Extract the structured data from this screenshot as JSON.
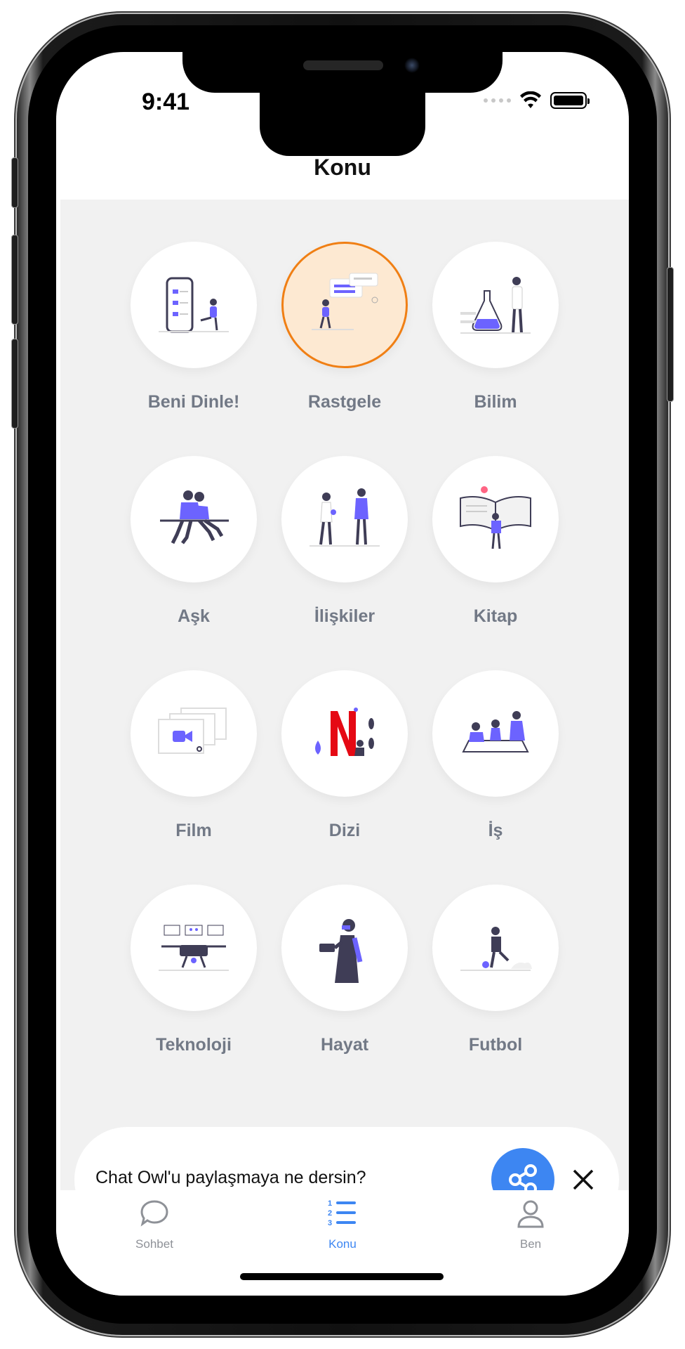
{
  "status_bar": {
    "time": "9:41"
  },
  "header": {
    "title": "Konu"
  },
  "topics": [
    {
      "label": "Beni Dinle!",
      "icon": "phone-checklist-illustration",
      "selected": false
    },
    {
      "label": "Rastgele",
      "icon": "chat-messages-illustration",
      "selected": true
    },
    {
      "label": "Bilim",
      "icon": "science-lab-illustration",
      "selected": false
    },
    {
      "label": "Aşk",
      "icon": "couple-sitting-illustration",
      "selected": false
    },
    {
      "label": "İlişkiler",
      "icon": "two-people-talking-illustration",
      "selected": false
    },
    {
      "label": "Kitap",
      "icon": "open-book-illustration",
      "selected": false
    },
    {
      "label": "Film",
      "icon": "video-camera-illustration",
      "selected": false
    },
    {
      "label": "Dizi",
      "icon": "netflix-logo-illustration",
      "selected": false
    },
    {
      "label": "İş",
      "icon": "office-meeting-illustration",
      "selected": false
    },
    {
      "label": "Teknoloji",
      "icon": "drone-illustration",
      "selected": false
    },
    {
      "label": "Hayat",
      "icon": "person-with-vr-illustration",
      "selected": false
    },
    {
      "label": "Futbol",
      "icon": "football-player-illustration",
      "selected": false
    }
  ],
  "share_banner": {
    "text": "Chat Owl'u paylaşmaya ne dersin?"
  },
  "tabs": [
    {
      "label": "Sohbet",
      "icon": "chat-bubble-icon",
      "active": false
    },
    {
      "label": "Konu",
      "icon": "numbered-list-icon",
      "active": true
    },
    {
      "label": "Ben",
      "icon": "person-icon",
      "active": false
    }
  ],
  "colors": {
    "accent": "#3d86f2",
    "selected_border": "#f07f14",
    "selected_fill": "#fde9d2",
    "illustration_purple": "#6c63ff",
    "label_gray": "#727986",
    "tab_inactive": "#8e9197"
  }
}
